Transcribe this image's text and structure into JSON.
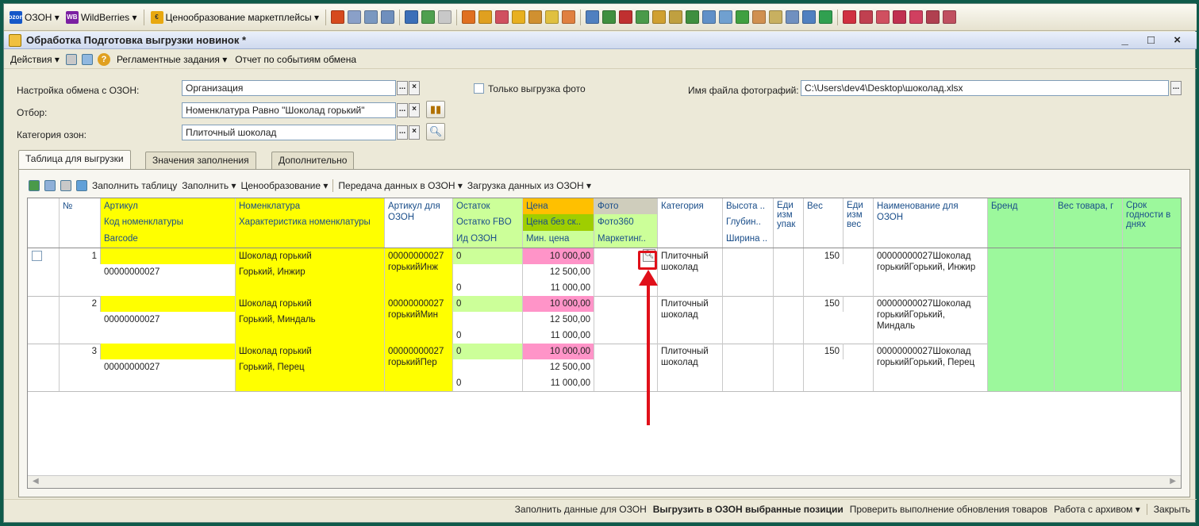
{
  "toolbar": {
    "menus": [
      "ОЗОН",
      "WildBerries",
      "Ценообразование маркетплейсы"
    ],
    "ozon_icon_text": "ozon",
    "wb_icon_text": "WB",
    "price_icon_text": "€"
  },
  "window": {
    "title": "Обработка  Подготовка выгрузки новинок *",
    "controls": "_ □ ×"
  },
  "actions": {
    "actions_label": "Действия",
    "help_glyph": "?",
    "scheduled": "Регламентные задания",
    "log": "Отчет по событиям обмена"
  },
  "form": {
    "exchange_label": "Настройка обмена с ОЗОН:",
    "exchange_value": "Организация",
    "filter_label": "Отбор:",
    "filter_value": "Номенклатура Равно \"Шоколад горький\"",
    "category_label": "Категория озон:",
    "category_value": "Плиточный шоколад",
    "photo_only_label": "Только выгрузка фото",
    "photo_file_label": "Имя файла фотографий:",
    "photo_file_value": "C:\\Users\\dev4\\Desktop\\шоколад.xlsx",
    "dots": "...",
    "clear": "×"
  },
  "tabs": [
    "Таблица для выгрузки",
    "Значения заполнения",
    "Дополнительно"
  ],
  "tab_toolbar": {
    "fill_table": "Заполнить таблицу",
    "fill": "Заполнить",
    "pricing": "Ценообразование",
    "send": "Передача данных в ОЗОН",
    "load": "Загрузка данных из ОЗОН"
  },
  "grid": {
    "headers": {
      "num": "№",
      "article": "Артикул",
      "code": "Код номенклатуры",
      "barcode": "Barcode",
      "nomenclature": "Номенклатура",
      "characteristic": "Характеристика номенклатуры",
      "ozon_article": "Артикул для ОЗОН",
      "stock": "Остаток",
      "stock_fbo": "Остатко FBO",
      "ozon_id": "Ид ОЗОН",
      "price": "Цена",
      "price_no_disc": "Цена без ск..",
      "min_price": "Мин. цена",
      "photo": "Фото",
      "photo360": "Фото360",
      "marketing": "Маркетинг..",
      "category": "Категория",
      "height": "Высота ..",
      "depth": "Глубин..",
      "width": "Ширина ..",
      "unit_pack": "Еди изм упак",
      "weight": "Вес",
      "unit_weight": "Еди изм вес",
      "ozon_name": "Наименование для ОЗОН",
      "brand": "Бренд",
      "product_weight": "Вес товара, г",
      "shelf_life": "Срок годности в днях"
    },
    "rows": [
      {
        "num": "1",
        "code": "00000000027",
        "nomenclature": "Шоколад горький",
        "characteristic": "Горький, Инжир",
        "ozon_article": "00000000027 горькийИнж",
        "stock": "0",
        "ozon_id": "0",
        "price": "10 000,00",
        "price_no_disc": "12 500,00",
        "min_price": "11 000,00",
        "category": "Плиточный шоколад",
        "weight": "150",
        "ozon_name": "00000000027Шоколад горькийГорький, Инжир"
      },
      {
        "num": "2",
        "code": "00000000027",
        "nomenclature": "Шоколад горький",
        "characteristic": "Горький, Миндаль",
        "ozon_article": "00000000027 горькийМин",
        "stock": "0",
        "ozon_id": "0",
        "price": "10 000,00",
        "price_no_disc": "12 500,00",
        "min_price": "11 000,00",
        "category": "Плиточный шоколад",
        "weight": "150",
        "ozon_name": "00000000027Шоколад горькийГорький, Миндаль"
      },
      {
        "num": "3",
        "code": "00000000027",
        "nomenclature": "Шоколад горький",
        "characteristic": "Горький, Перец",
        "ozon_article": "00000000027 горькийПер",
        "stock": "0",
        "ozon_id": "0",
        "price": "10 000,00",
        "price_no_disc": "12 500,00",
        "min_price": "11 000,00",
        "category": "Плиточный шоколад",
        "weight": "150",
        "ozon_name": "00000000027Шоколад горькийГорький, Перец"
      }
    ]
  },
  "bottom": {
    "fill_data": "Заполнить данные для ОЗОН",
    "upload_selected": "Выгрузить в ОЗОН выбранные позиции",
    "check_update": "Проверить выполнение обновления товаров",
    "archive": "Работа с архивом",
    "close": "Закрыть"
  },
  "colors": {
    "background": "#0f5a4a",
    "yellow": "#ffff00",
    "green": "#9cf89c",
    "pink": "#ff94c8",
    "orange": "#ffc000",
    "annotation": "#e0101a"
  }
}
